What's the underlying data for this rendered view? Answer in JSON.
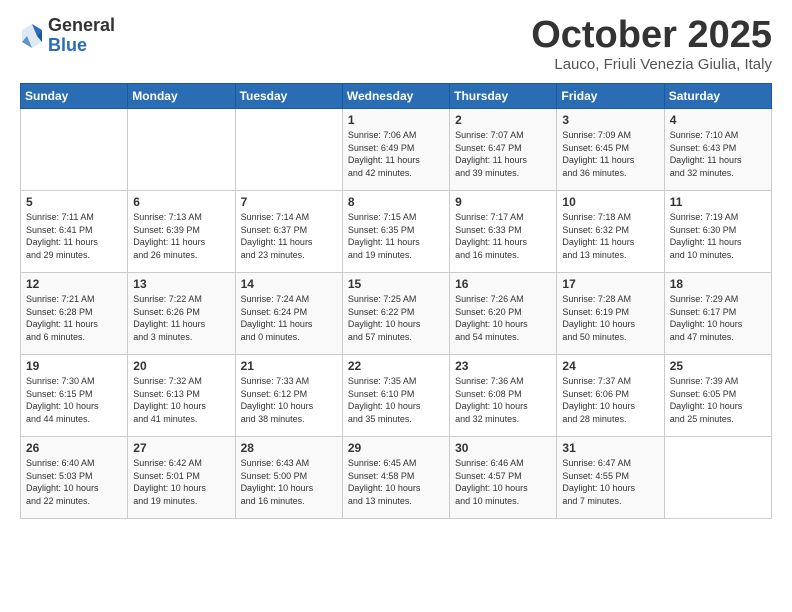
{
  "logo": {
    "general": "General",
    "blue": "Blue"
  },
  "title": "October 2025",
  "subtitle": "Lauco, Friuli Venezia Giulia, Italy",
  "headers": [
    "Sunday",
    "Monday",
    "Tuesday",
    "Wednesday",
    "Thursday",
    "Friday",
    "Saturday"
  ],
  "weeks": [
    [
      {
        "day": "",
        "info": ""
      },
      {
        "day": "",
        "info": ""
      },
      {
        "day": "",
        "info": ""
      },
      {
        "day": "1",
        "info": "Sunrise: 7:06 AM\nSunset: 6:49 PM\nDaylight: 11 hours\nand 42 minutes."
      },
      {
        "day": "2",
        "info": "Sunrise: 7:07 AM\nSunset: 6:47 PM\nDaylight: 11 hours\nand 39 minutes."
      },
      {
        "day": "3",
        "info": "Sunrise: 7:09 AM\nSunset: 6:45 PM\nDaylight: 11 hours\nand 36 minutes."
      },
      {
        "day": "4",
        "info": "Sunrise: 7:10 AM\nSunset: 6:43 PM\nDaylight: 11 hours\nand 32 minutes."
      }
    ],
    [
      {
        "day": "5",
        "info": "Sunrise: 7:11 AM\nSunset: 6:41 PM\nDaylight: 11 hours\nand 29 minutes."
      },
      {
        "day": "6",
        "info": "Sunrise: 7:13 AM\nSunset: 6:39 PM\nDaylight: 11 hours\nand 26 minutes."
      },
      {
        "day": "7",
        "info": "Sunrise: 7:14 AM\nSunset: 6:37 PM\nDaylight: 11 hours\nand 23 minutes."
      },
      {
        "day": "8",
        "info": "Sunrise: 7:15 AM\nSunset: 6:35 PM\nDaylight: 11 hours\nand 19 minutes."
      },
      {
        "day": "9",
        "info": "Sunrise: 7:17 AM\nSunset: 6:33 PM\nDaylight: 11 hours\nand 16 minutes."
      },
      {
        "day": "10",
        "info": "Sunrise: 7:18 AM\nSunset: 6:32 PM\nDaylight: 11 hours\nand 13 minutes."
      },
      {
        "day": "11",
        "info": "Sunrise: 7:19 AM\nSunset: 6:30 PM\nDaylight: 11 hours\nand 10 minutes."
      }
    ],
    [
      {
        "day": "12",
        "info": "Sunrise: 7:21 AM\nSunset: 6:28 PM\nDaylight: 11 hours\nand 6 minutes."
      },
      {
        "day": "13",
        "info": "Sunrise: 7:22 AM\nSunset: 6:26 PM\nDaylight: 11 hours\nand 3 minutes."
      },
      {
        "day": "14",
        "info": "Sunrise: 7:24 AM\nSunset: 6:24 PM\nDaylight: 11 hours\nand 0 minutes."
      },
      {
        "day": "15",
        "info": "Sunrise: 7:25 AM\nSunset: 6:22 PM\nDaylight: 10 hours\nand 57 minutes."
      },
      {
        "day": "16",
        "info": "Sunrise: 7:26 AM\nSunset: 6:20 PM\nDaylight: 10 hours\nand 54 minutes."
      },
      {
        "day": "17",
        "info": "Sunrise: 7:28 AM\nSunset: 6:19 PM\nDaylight: 10 hours\nand 50 minutes."
      },
      {
        "day": "18",
        "info": "Sunrise: 7:29 AM\nSunset: 6:17 PM\nDaylight: 10 hours\nand 47 minutes."
      }
    ],
    [
      {
        "day": "19",
        "info": "Sunrise: 7:30 AM\nSunset: 6:15 PM\nDaylight: 10 hours\nand 44 minutes."
      },
      {
        "day": "20",
        "info": "Sunrise: 7:32 AM\nSunset: 6:13 PM\nDaylight: 10 hours\nand 41 minutes."
      },
      {
        "day": "21",
        "info": "Sunrise: 7:33 AM\nSunset: 6:12 PM\nDaylight: 10 hours\nand 38 minutes."
      },
      {
        "day": "22",
        "info": "Sunrise: 7:35 AM\nSunset: 6:10 PM\nDaylight: 10 hours\nand 35 minutes."
      },
      {
        "day": "23",
        "info": "Sunrise: 7:36 AM\nSunset: 6:08 PM\nDaylight: 10 hours\nand 32 minutes."
      },
      {
        "day": "24",
        "info": "Sunrise: 7:37 AM\nSunset: 6:06 PM\nDaylight: 10 hours\nand 28 minutes."
      },
      {
        "day": "25",
        "info": "Sunrise: 7:39 AM\nSunset: 6:05 PM\nDaylight: 10 hours\nand 25 minutes."
      }
    ],
    [
      {
        "day": "26",
        "info": "Sunrise: 6:40 AM\nSunset: 5:03 PM\nDaylight: 10 hours\nand 22 minutes."
      },
      {
        "day": "27",
        "info": "Sunrise: 6:42 AM\nSunset: 5:01 PM\nDaylight: 10 hours\nand 19 minutes."
      },
      {
        "day": "28",
        "info": "Sunrise: 6:43 AM\nSunset: 5:00 PM\nDaylight: 10 hours\nand 16 minutes."
      },
      {
        "day": "29",
        "info": "Sunrise: 6:45 AM\nSunset: 4:58 PM\nDaylight: 10 hours\nand 13 minutes."
      },
      {
        "day": "30",
        "info": "Sunrise: 6:46 AM\nSunset: 4:57 PM\nDaylight: 10 hours\nand 10 minutes."
      },
      {
        "day": "31",
        "info": "Sunrise: 6:47 AM\nSunset: 4:55 PM\nDaylight: 10 hours\nand 7 minutes."
      },
      {
        "day": "",
        "info": ""
      }
    ]
  ]
}
